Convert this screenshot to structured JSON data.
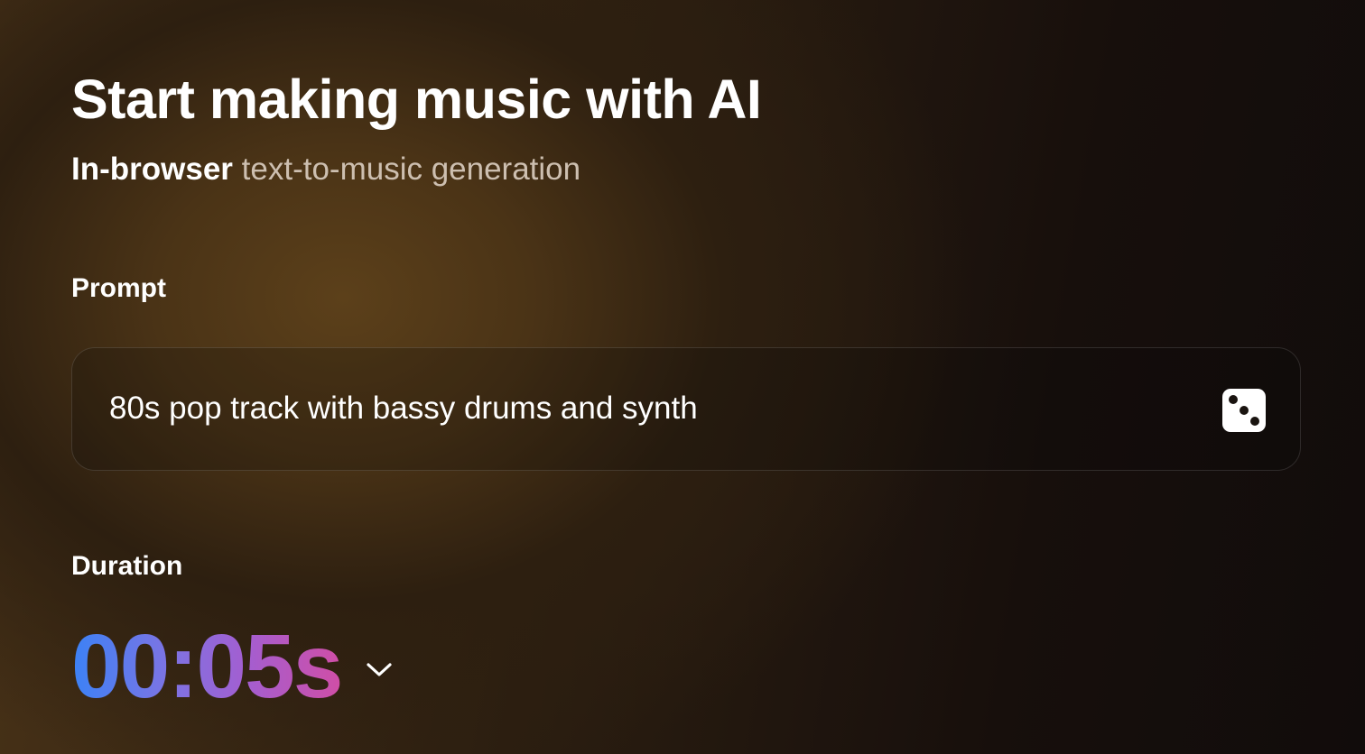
{
  "header": {
    "title": "Start making music with AI",
    "subtitle_strong": "In-browser",
    "subtitle_rest": "text-to-music generation"
  },
  "prompt": {
    "label": "Prompt",
    "value": "80s pop track with bassy drums and synth",
    "randomize_icon": "dice-icon"
  },
  "duration": {
    "label": "Duration",
    "value": "00:05s",
    "toggle_icon": "chevron-down-icon"
  },
  "colors": {
    "gradient_start": "#3b82f6",
    "gradient_mid": "#a45ed0",
    "gradient_end": "#d04ea6",
    "background_warm": "#5c401a",
    "background_dark": "#110c0b"
  }
}
